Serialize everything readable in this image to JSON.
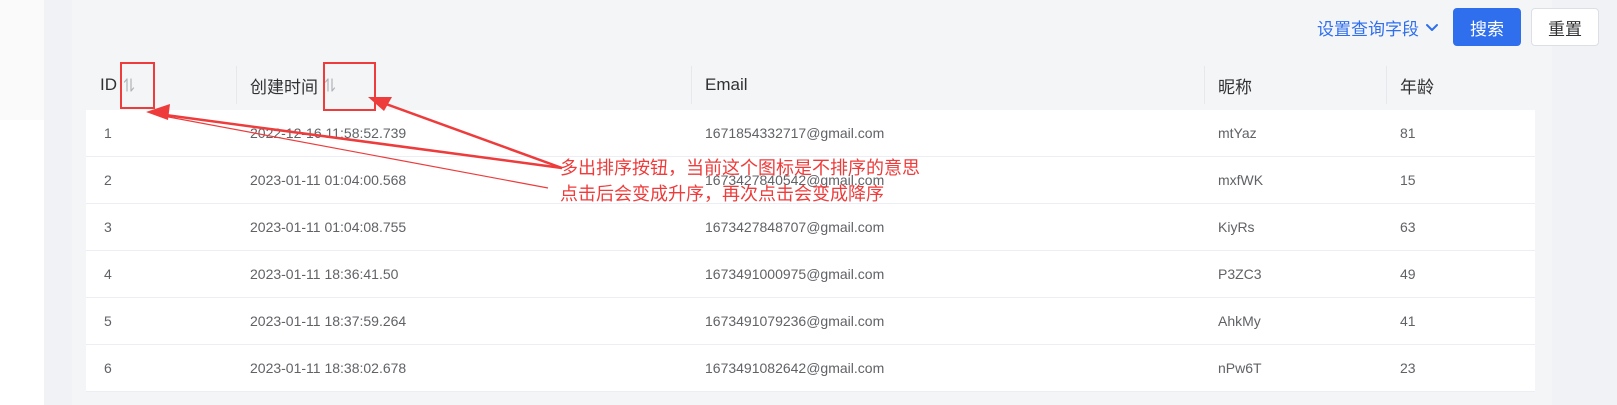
{
  "toolbar": {
    "field_config_label": "设置查询字段",
    "search_label": "搜索",
    "reset_label": "重置",
    "accent_color": "#2f6fed"
  },
  "table": {
    "headers": {
      "id": "ID",
      "created": "创建时间",
      "email": "Email",
      "nickname": "昵称",
      "age": "年龄"
    },
    "rows": [
      {
        "id": "1",
        "created": "2022-12-16 11:58:52.739",
        "email": "1671854332717@gmail.com",
        "nickname": "mtYaz",
        "age": "81"
      },
      {
        "id": "2",
        "created": "2023-01-11 01:04:00.568",
        "email": "1673427840542@gmail.com",
        "nickname": "mxfWK",
        "age": "15"
      },
      {
        "id": "3",
        "created": "2023-01-11 01:04:08.755",
        "email": "1673427848707@gmail.com",
        "nickname": "KiyRs",
        "age": "63"
      },
      {
        "id": "4",
        "created": "2023-01-11 18:36:41.50",
        "email": "1673491000975@gmail.com",
        "nickname": "P3ZC3",
        "age": "49"
      },
      {
        "id": "5",
        "created": "2023-01-11 18:37:59.264",
        "email": "1673491079236@gmail.com",
        "nickname": "AhkMy",
        "age": "41"
      },
      {
        "id": "6",
        "created": "2023-01-11 18:38:02.678",
        "email": "1673491082642@gmail.com",
        "nickname": "nPw6T",
        "age": "23"
      }
    ]
  },
  "annotation": {
    "line1": "多出排序按钮，当前这个图标是不排序的意思",
    "line2": "点击后会变成升序，再次点击会变成降序",
    "color": "#ee3b3b"
  },
  "icons": {
    "sort": "sort-icon",
    "chevron": "chevron-down-icon"
  }
}
